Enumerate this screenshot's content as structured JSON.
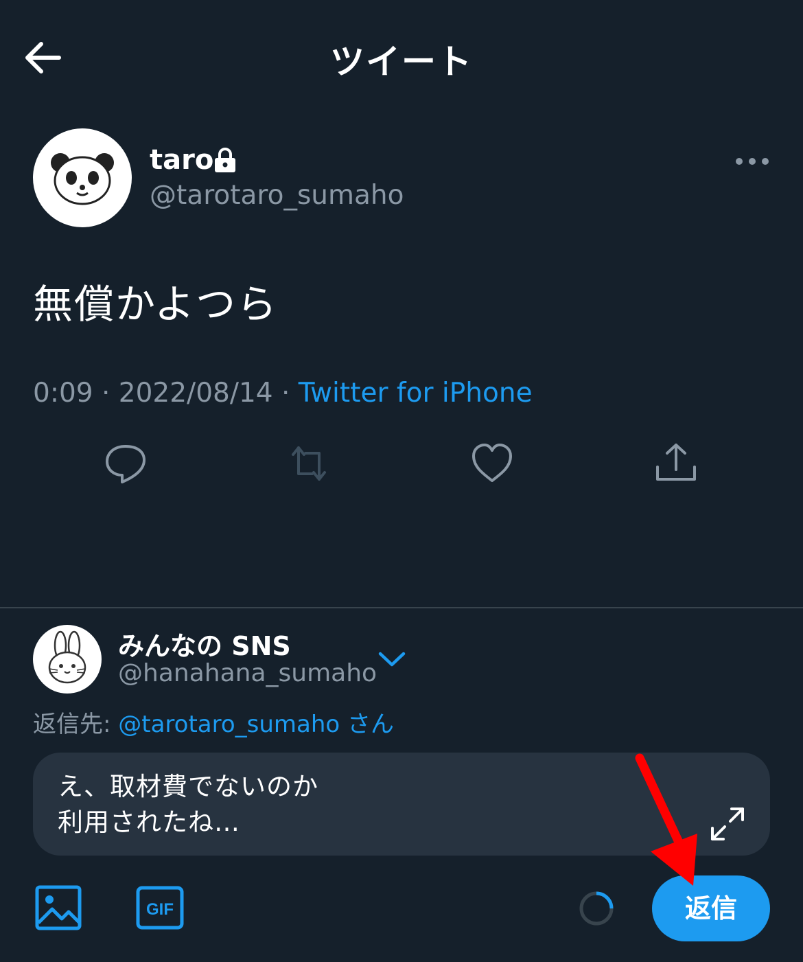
{
  "header": {
    "title": "ツイート",
    "back_icon": "arrow-left-icon"
  },
  "tweet": {
    "author_name": "taro",
    "author_handle": "@tarotaro_sumaho",
    "protected_icon": "lock-icon",
    "text": "無償かよつら",
    "time": "0:09",
    "date": "2022/08/14",
    "separator": " · ",
    "source": "Twitter for iPhone",
    "actions": [
      "reply-icon",
      "retweet-icon",
      "like-icon",
      "share-icon"
    ]
  },
  "composer": {
    "account_name": "みんなの SNS",
    "account_handle": "@hanahana_sumaho",
    "reply_to_label": "返信先: ",
    "reply_to_handle": "@tarotaro_sumaho",
    "reply_to_suffix": " さん",
    "text": "え、取材費でないのか\n利用されたね…",
    "toolbar_icons": [
      "image-icon",
      "gif-icon",
      "progress-ring-icon"
    ],
    "reply_button_label": "返信"
  },
  "colors": {
    "background": "#15202b",
    "accent": "#1d9bf0",
    "secondary_text": "#8b98a5",
    "input_background": "#273340",
    "annotation": "#ff0000"
  }
}
